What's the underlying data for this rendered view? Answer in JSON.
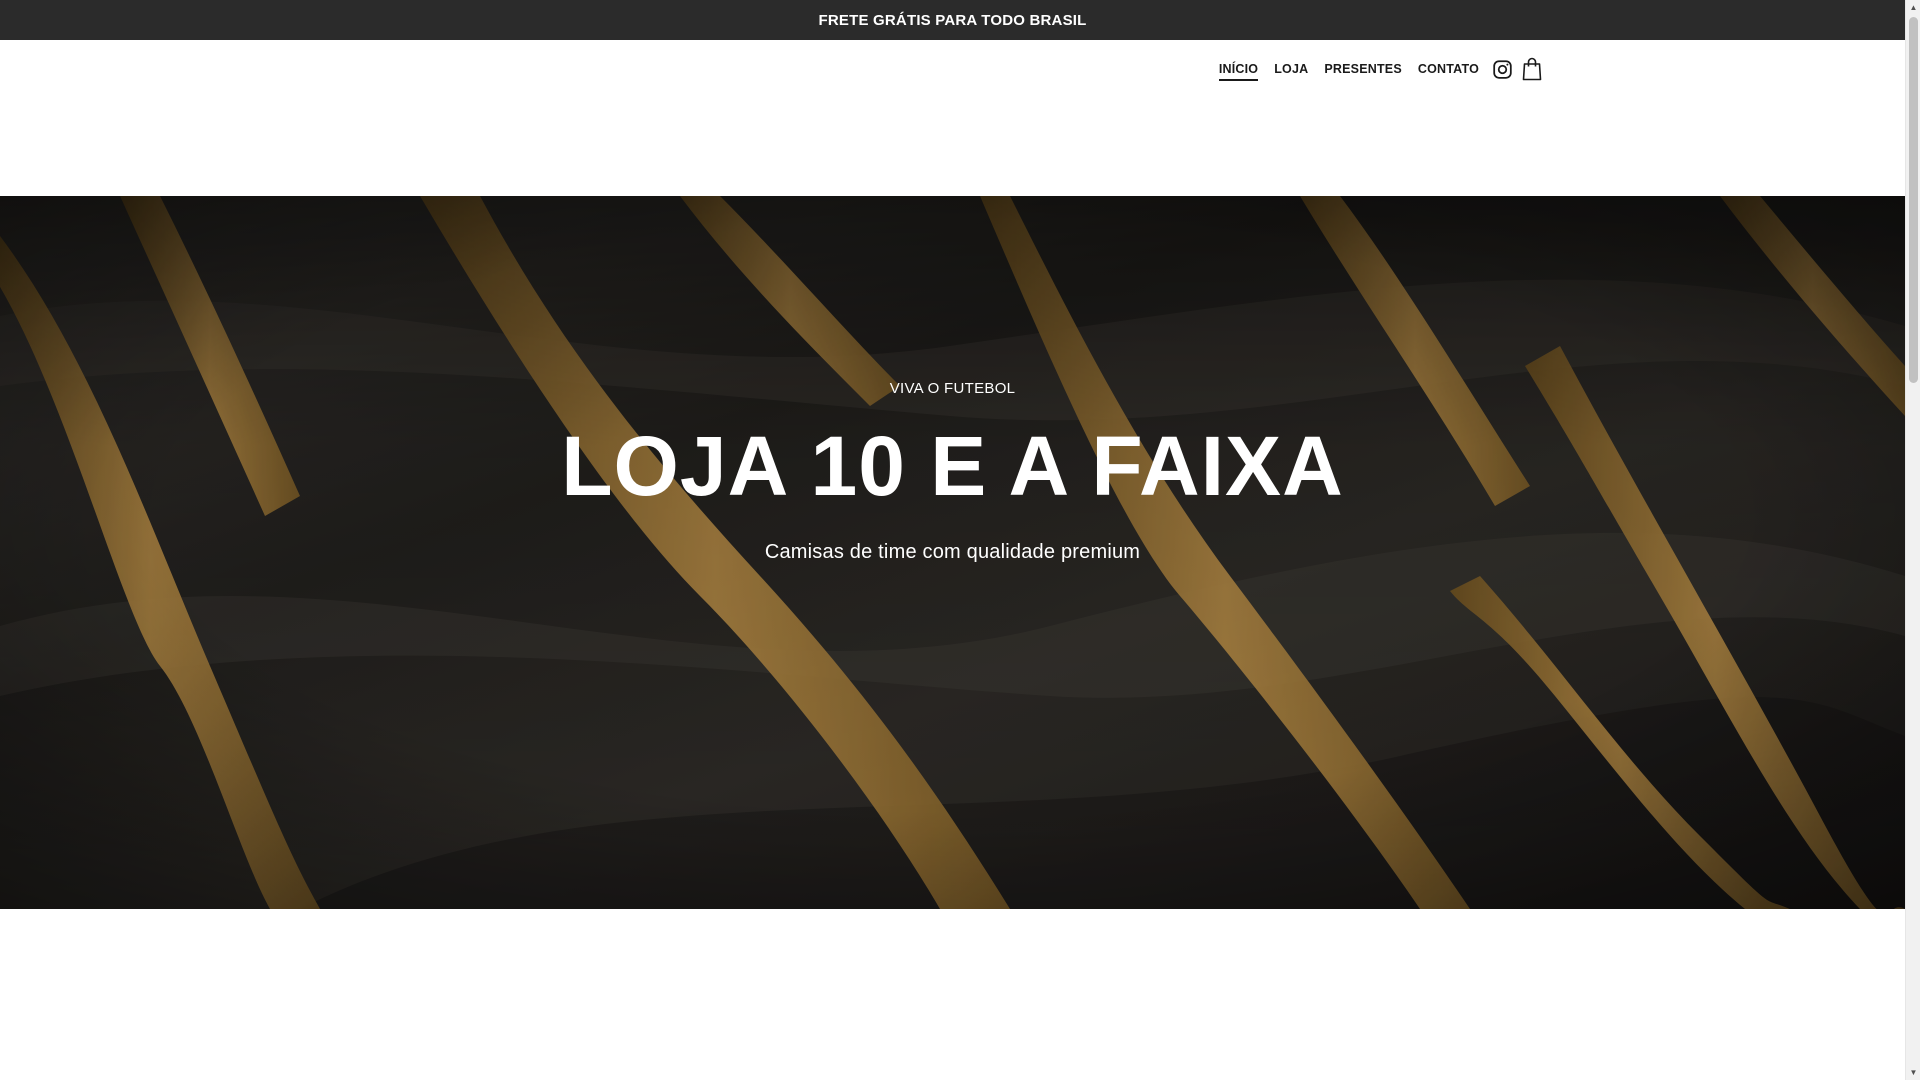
{
  "announcement": {
    "text": "FRETE GRÁTIS PARA TODO BRASIL"
  },
  "nav": {
    "items": [
      {
        "label": "INÍCIO",
        "active": true
      },
      {
        "label": "LOJA",
        "active": false
      },
      {
        "label": "PRESENTES",
        "active": false
      },
      {
        "label": "CONTATO",
        "active": false
      }
    ],
    "icons": [
      "instagram-icon",
      "shopping-bag-icon"
    ]
  },
  "hero": {
    "eyebrow": "VIVA O FUTEBOL",
    "title": "LOJA 10 E A FAIXA",
    "subtitle": "Camisas de time com qualidade premium",
    "background": "dark fabric with gold stripes"
  },
  "colors": {
    "announcement_bg": "#2b2b2b",
    "fabric_dark": "#2a2825",
    "stripe_gold": "#b8893e",
    "text_dark": "#1a1a1a",
    "white": "#ffffff"
  },
  "scrollbar": {
    "up_arrow": "▲",
    "down_arrow": "▼"
  }
}
